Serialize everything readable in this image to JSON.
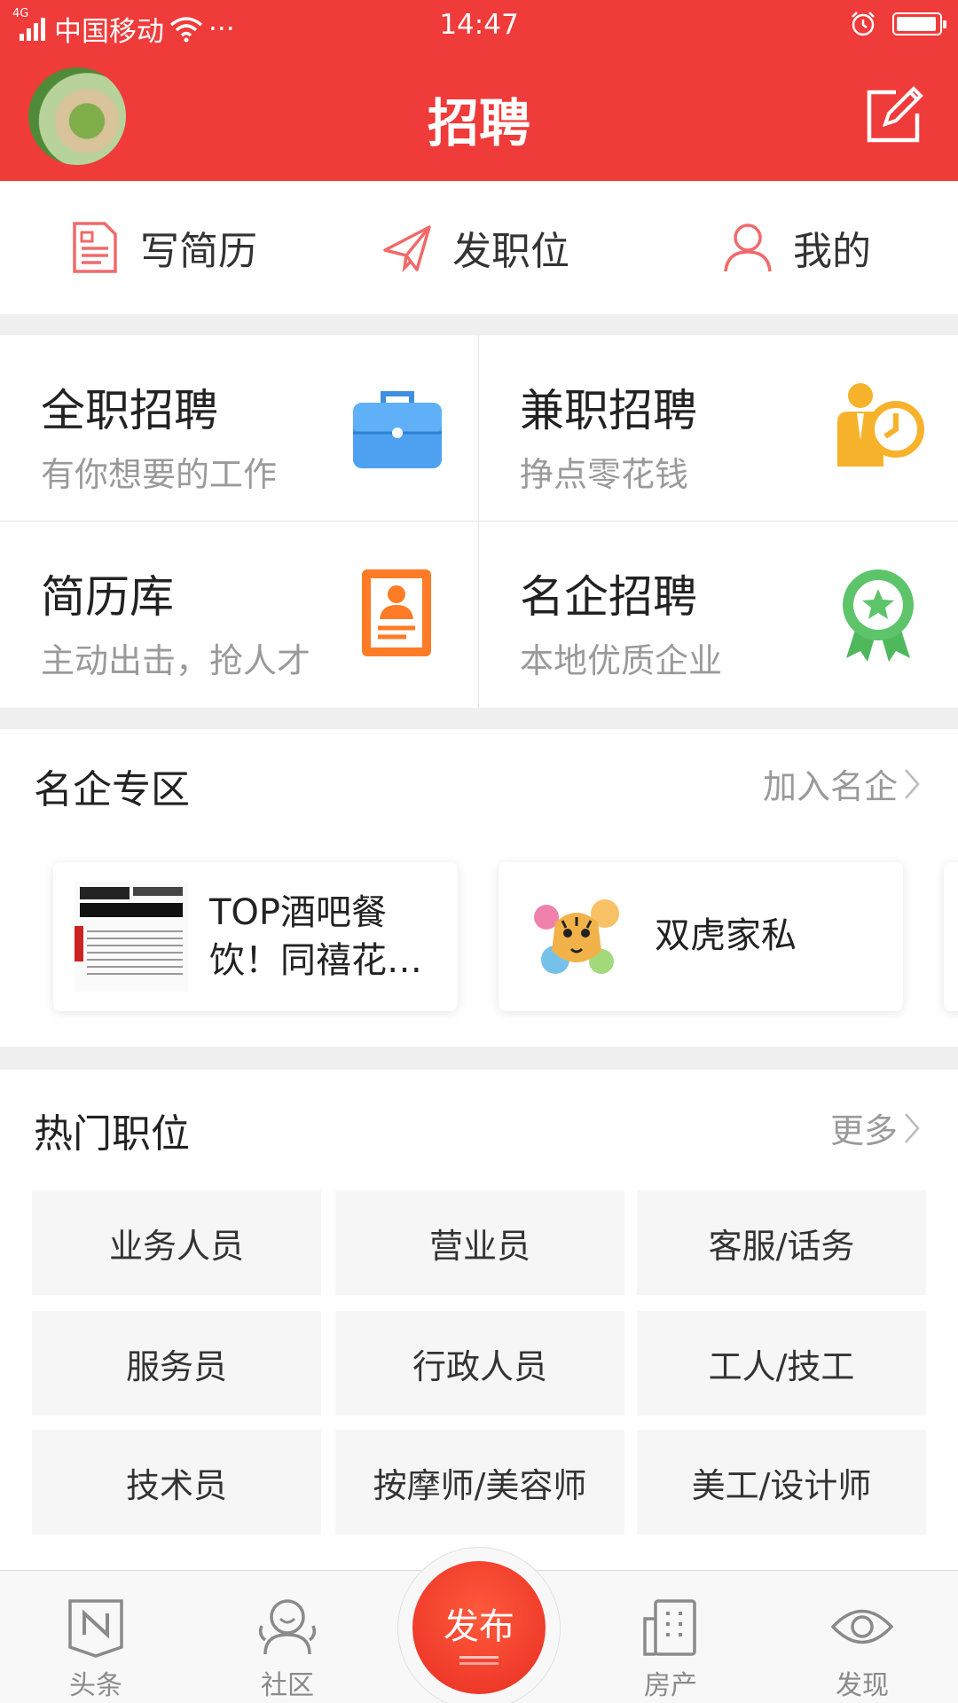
{
  "status_bar": {
    "network": "4G",
    "carrier": "中国移动",
    "more": "···",
    "time": "14:47",
    "battery_level": 0.95
  },
  "header": {
    "title": "招聘"
  },
  "quick_actions": [
    {
      "label": "写简历",
      "icon": "resume-icon"
    },
    {
      "label": "发职位",
      "icon": "paper-plane-icon"
    },
    {
      "label": "我的",
      "icon": "user-icon"
    }
  ],
  "categories": [
    {
      "title": "全职招聘",
      "subtitle": "有你想要的工作",
      "icon": "briefcase-icon"
    },
    {
      "title": "兼职招聘",
      "subtitle": "挣点零花钱",
      "icon": "person-clock-icon"
    },
    {
      "title": "简历库",
      "subtitle": "主动出击，抢人才",
      "icon": "resume-card-icon"
    },
    {
      "title": "名企招聘",
      "subtitle": "本地优质企业",
      "icon": "award-badge-icon"
    }
  ],
  "featured": {
    "title": "名企专区",
    "more": "加入名企",
    "companies": [
      {
        "name_line1": "TOP酒吧餐",
        "name_line2": "饮！同禧花…",
        "logo": "hotpot-poster-logo"
      },
      {
        "name": "双虎家私",
        "logo": "tiger-logo"
      }
    ]
  },
  "hot_jobs": {
    "title": "热门职位",
    "more": "更多",
    "items": [
      "业务人员",
      "营业员",
      "客服/话务",
      "服务员",
      "行政人员",
      "工人/技工",
      "技术员",
      "按摩师/美容师",
      "美工/设计师"
    ]
  },
  "tab_bar": {
    "items": [
      {
        "label": "头条",
        "icon": "news-icon"
      },
      {
        "label": "社区",
        "icon": "community-icon"
      },
      {
        "label": "房产",
        "icon": "building-icon"
      },
      {
        "label": "发现",
        "icon": "eye-icon"
      }
    ],
    "publish": "发布"
  },
  "colors": {
    "brand": "#ef3b3a",
    "muted_text": "#9a9a9a",
    "tag_bg": "#f6f6f6"
  }
}
